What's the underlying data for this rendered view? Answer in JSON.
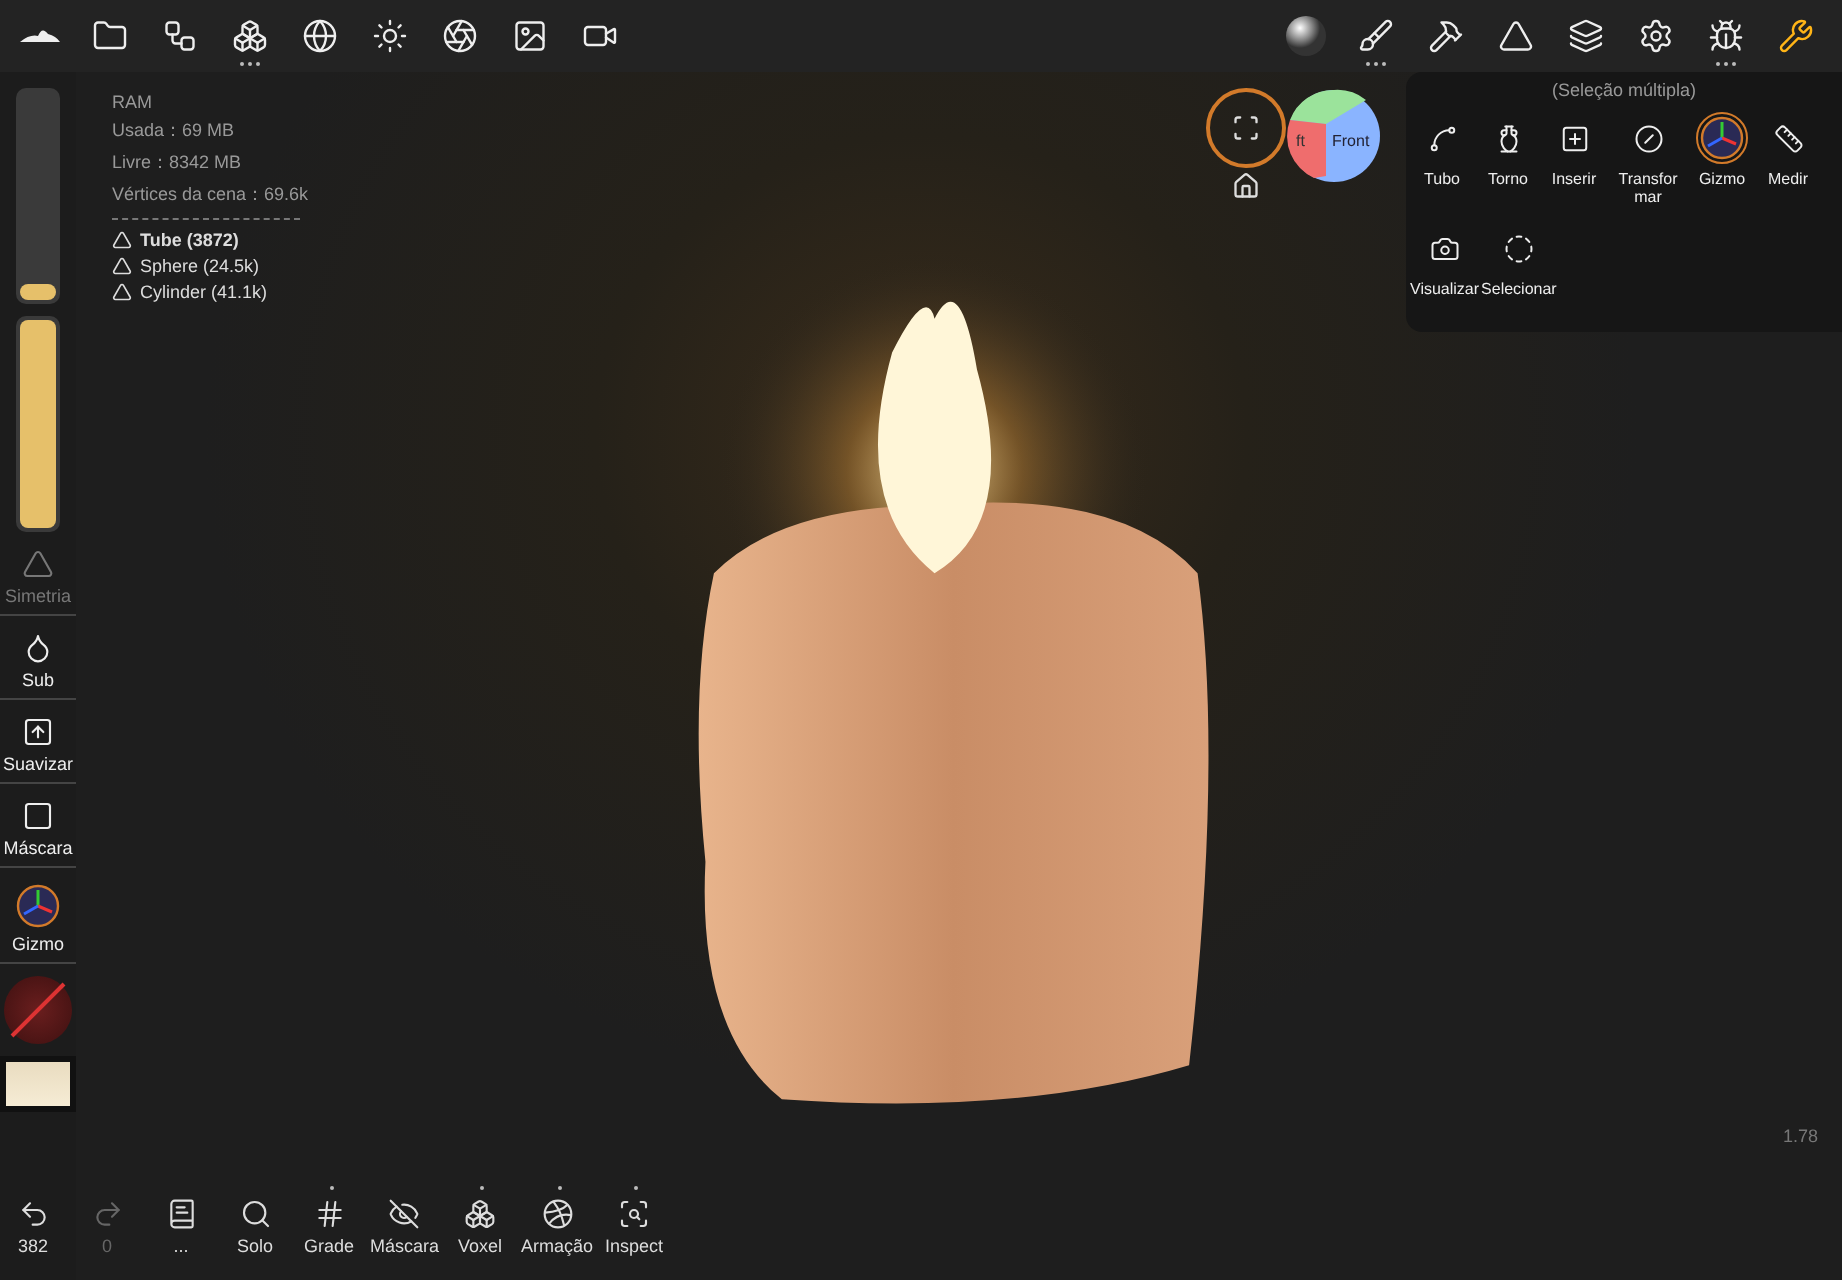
{
  "top_bar": {
    "left_tools": [
      {
        "more": false
      },
      {
        "more": false
      },
      {
        "more": false
      },
      {
        "more": true
      },
      {
        "more": false
      },
      {
        "more": false
      },
      {
        "more": false
      },
      {
        "more": false
      },
      {
        "more": false
      }
    ],
    "right_tools": [
      {
        "more": false,
        "selected": false
      },
      {
        "more": true,
        "selected": false
      },
      {
        "more": false,
        "selected": false
      },
      {
        "more": false,
        "selected": false
      },
      {
        "more": false,
        "selected": false
      },
      {
        "more": false,
        "selected": false
      },
      {
        "more": true,
        "selected": false
      },
      {
        "more": false,
        "selected": true
      }
    ]
  },
  "sliders": [
    {
      "level": 0.08
    },
    {
      "level": 1
    }
  ],
  "left_tools": [
    {
      "kind": "tool",
      "label": "Simetria",
      "disabled": true
    },
    {
      "kind": "tool",
      "label": "Sub",
      "disabled": false
    },
    {
      "kind": "tool",
      "label": "Suavizar",
      "disabled": false
    },
    {
      "kind": "tool",
      "label": "Máscara",
      "disabled": false
    },
    {
      "kind": "tool",
      "label": "Gizmo",
      "disabled": false
    },
    {
      "kind": "color"
    },
    {
      "kind": "material"
    }
  ],
  "stats": {
    "lines": [
      "RAM",
      "Usada：69 MB",
      "Livre：8342 MB",
      "Vértices da cena：69.6k"
    ],
    "objects": [
      {
        "label": "Tube (3872)",
        "selected": true
      },
      {
        "label": "Sphere (24.5k)",
        "selected": false
      },
      {
        "label": "Cylinder (41.1k)",
        "selected": false
      }
    ]
  },
  "view_cube": {
    "left": "ft",
    "front": "Front"
  },
  "tool_panel": {
    "title": "(Seleção múltipla)",
    "tools": [
      {
        "label": "Tubo",
        "selected": false
      },
      {
        "label": "Torno",
        "selected": false
      },
      {
        "label": "Inserir",
        "selected": false
      },
      {
        "label": "Transfor mar",
        "selected": false
      },
      {
        "label": "Gizmo",
        "selected": true
      },
      {
        "label": "Medir",
        "selected": false
      },
      {
        "label": "Visualizar",
        "selected": false
      },
      {
        "label": "Selecionar",
        "selected": false
      }
    ]
  },
  "bottom_bar": [
    {
      "label": "382",
      "disabled": false,
      "more": false
    },
    {
      "label": "0",
      "disabled": true,
      "more": false
    },
    {
      "label": "...",
      "disabled": false,
      "more": false
    },
    {
      "label": "Solo",
      "disabled": false,
      "more": false
    },
    {
      "label": "Grade",
      "disabled": false,
      "more": true
    },
    {
      "label": "Máscara",
      "disabled": false,
      "more": false
    },
    {
      "label": "Voxel",
      "disabled": false,
      "more": true
    },
    {
      "label": "Armação",
      "disabled": false,
      "more": true
    },
    {
      "label": "Inspect",
      "disabled": false,
      "more": true
    }
  ],
  "version": "1.78"
}
